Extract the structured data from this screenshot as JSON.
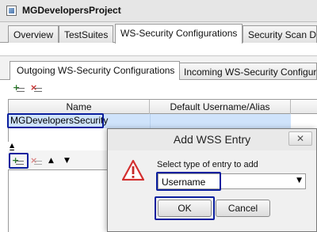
{
  "window": {
    "title": "MGDevelopersProject"
  },
  "top_tabs": [
    {
      "label": "Overview"
    },
    {
      "label": "TestSuites"
    },
    {
      "label": "WS-Security Configurations",
      "active": true
    },
    {
      "label": "Security Scan Def"
    }
  ],
  "sub_tabs": [
    {
      "label": "Outgoing WS-Security Configurations",
      "active": true
    },
    {
      "label": "Incoming WS-Security Configurat"
    }
  ],
  "toolbar": {
    "add_icon": "add-row-icon",
    "remove_icon": "remove-row-icon"
  },
  "table": {
    "columns": [
      "Name",
      "Default Username/Alias"
    ],
    "rows": [
      {
        "name": "MGDevelopersSecurity",
        "alias": ""
      }
    ]
  },
  "lower_toolbar": {
    "icons": [
      "add-entry-icon",
      "remove-entry-icon",
      "move-up-icon",
      "move-down-icon"
    ]
  },
  "dialog": {
    "title": "Add WSS Entry",
    "close_glyph": "✕",
    "prompt": "Select type of entry to add",
    "selected_type": "Username",
    "ok_label": "OK",
    "cancel_label": "Cancel"
  },
  "colors": {
    "highlight_border": "#0b1f9e",
    "selected_row": "#cfe3fb",
    "warning_red": "#d32f2f"
  }
}
